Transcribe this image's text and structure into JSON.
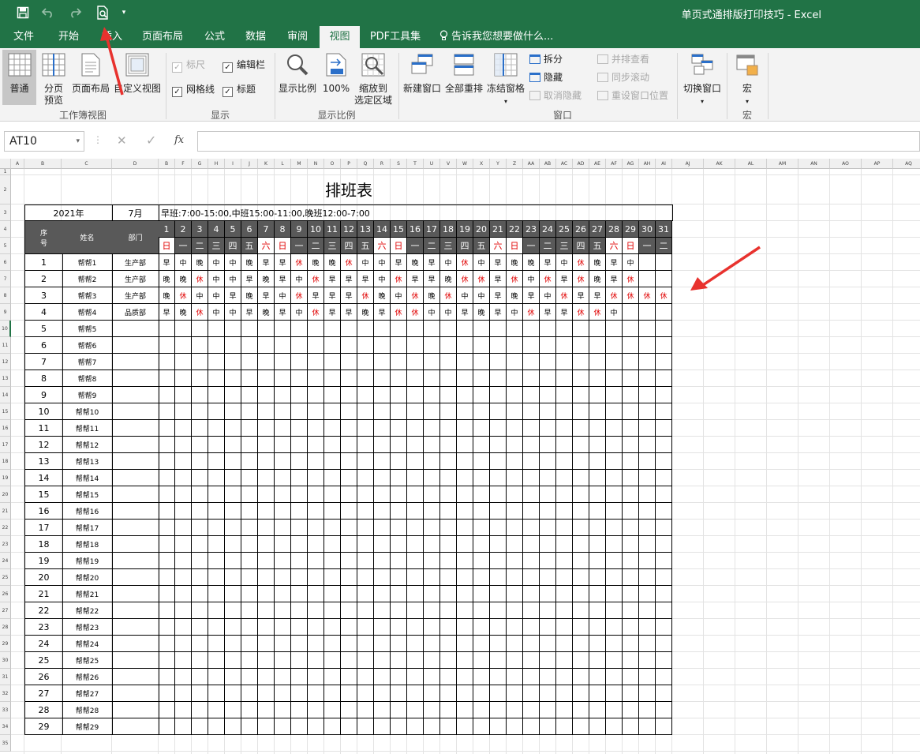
{
  "app": {
    "window_title": "单页式通排版打印技巧 - Excel"
  },
  "quick_access": {
    "save_icon": "save-icon",
    "undo_icon": "undo-icon",
    "redo_icon": "redo-icon",
    "print_preview_icon": "print-preview-icon",
    "customize_icon": "chevron-down-icon"
  },
  "tabs": [
    {
      "label": "文件"
    },
    {
      "label": "开始"
    },
    {
      "label": "插入"
    },
    {
      "label": "页面布局"
    },
    {
      "label": "公式"
    },
    {
      "label": "数据"
    },
    {
      "label": "审阅"
    },
    {
      "label": "视图"
    },
    {
      "label": "PDF工具集"
    }
  ],
  "tell_me": "告诉我您想要做什么...",
  "ribbon": {
    "workbook_views": {
      "label": "工作簿视图",
      "normal": "普通",
      "page_break_1": "分页",
      "page_break_2": "预览",
      "page_layout": "页面布局",
      "custom_views": "自定义视图"
    },
    "show": {
      "label": "显示",
      "ruler": "标尺",
      "formula_bar": "编辑栏",
      "gridlines": "网格线",
      "headings": "标题"
    },
    "zoom": {
      "label": "显示比例",
      "zoom": "显示比例",
      "hundred": "100%",
      "sel_1": "缩放到",
      "sel_2": "选定区域"
    },
    "window": {
      "label": "窗口",
      "new_window": "新建窗口",
      "arrange_all": "全部重排",
      "freeze": "冻结窗格",
      "split": "拆分",
      "hide": "隐藏",
      "unhide": "取消隐藏",
      "side_by_side": "并排查看",
      "sync_scroll": "同步滚动",
      "reset_pos": "重设窗口位置",
      "switch": "切换窗口"
    },
    "macros": {
      "label": "宏",
      "macros": "宏"
    }
  },
  "formula_bar": {
    "name_box": "AT10",
    "cancel": "✕",
    "enter": "✓",
    "fx": "fx",
    "formula": ""
  },
  "col_letters": [
    "A",
    "B",
    "C",
    "D",
    "B",
    "F",
    "G",
    "H",
    "I",
    "J",
    "K",
    "L",
    "M",
    "N",
    "O",
    "P",
    "Q",
    "R",
    "S",
    "T",
    "U",
    "V",
    "W",
    "X",
    "Y",
    "Z",
    "AA",
    "AB",
    "AC",
    "AD",
    "AE",
    "AF",
    "AG",
    "AH",
    "AI",
    "AJ",
    "AK",
    "AL",
    "AM",
    "AN",
    "AO",
    "AP",
    "AQ"
  ],
  "schedule": {
    "title": "排班表",
    "year": "2021年",
    "month": "7月",
    "legend": "早班:7:00-15:00,中班15:00-11:00,晚班12:00-7:00",
    "col_seq_1": "序",
    "col_seq_2": "号",
    "col_name": "姓名",
    "col_dept": "部门",
    "days": [
      "1",
      "2",
      "3",
      "4",
      "5",
      "6",
      "7",
      "8",
      "9",
      "10",
      "11",
      "12",
      "13",
      "14",
      "15",
      "16",
      "17",
      "18",
      "19",
      "20",
      "21",
      "22",
      "23",
      "24",
      "25",
      "26",
      "27",
      "28",
      "29",
      "30",
      "31"
    ],
    "weekdays": [
      "日",
      "一",
      "二",
      "三",
      "四",
      "五",
      "六",
      "日",
      "一",
      "二",
      "三",
      "四",
      "五",
      "六",
      "日",
      "一",
      "二",
      "三",
      "四",
      "五",
      "六",
      "日",
      "一",
      "二",
      "三",
      "四",
      "五",
      "六",
      "日",
      "一",
      "二"
    ],
    "rows": [
      {
        "seq": "1",
        "name": "帮帮1",
        "dept": "生产部",
        "shifts": [
          "早",
          "中",
          "晚",
          "中",
          "中",
          "晚",
          "早",
          "早",
          "休",
          "晚",
          "晚",
          "休",
          "中",
          "中",
          "早",
          "晚",
          "早",
          "中",
          "休",
          "中",
          "早",
          "晚",
          "晚",
          "早",
          "中",
          "休",
          "晚",
          "早",
          "中",
          "",
          ""
        ]
      },
      {
        "seq": "2",
        "name": "帮帮2",
        "dept": "生产部",
        "shifts": [
          "晚",
          "晚",
          "休",
          "中",
          "中",
          "早",
          "晚",
          "早",
          "中",
          "休",
          "早",
          "早",
          "早",
          "中",
          "休",
          "早",
          "早",
          "晚",
          "休",
          "休",
          "早",
          "休",
          "中",
          "休",
          "早",
          "休",
          "晚",
          "早",
          "休",
          "",
          ""
        ]
      },
      {
        "seq": "3",
        "name": "帮帮3",
        "dept": "生产部",
        "shifts": [
          "晚",
          "休",
          "中",
          "中",
          "早",
          "晚",
          "早",
          "中",
          "休",
          "早",
          "早",
          "早",
          "休",
          "晚",
          "中",
          "休",
          "晚",
          "休",
          "中",
          "中",
          "早",
          "晚",
          "早",
          "中",
          "休",
          "早",
          "早",
          "休",
          "休",
          "休",
          "休"
        ]
      },
      {
        "seq": "4",
        "name": "帮帮4",
        "dept": "品质部",
        "shifts": [
          "早",
          "晚",
          "休",
          "中",
          "中",
          "早",
          "晚",
          "早",
          "中",
          "休",
          "早",
          "早",
          "晚",
          "早",
          "休",
          "休",
          "中",
          "中",
          "早",
          "晚",
          "早",
          "中",
          "休",
          "早",
          "早",
          "休",
          "休",
          "中",
          "",
          "",
          ""
        ]
      },
      {
        "seq": "5",
        "name": "帮帮5",
        "dept": "",
        "shifts": []
      },
      {
        "seq": "6",
        "name": "帮帮6",
        "dept": "",
        "shifts": []
      },
      {
        "seq": "7",
        "name": "帮帮7",
        "dept": "",
        "shifts": []
      },
      {
        "seq": "8",
        "name": "帮帮8",
        "dept": "",
        "shifts": []
      },
      {
        "seq": "9",
        "name": "帮帮9",
        "dept": "",
        "shifts": []
      },
      {
        "seq": "10",
        "name": "帮帮10",
        "dept": "",
        "shifts": []
      },
      {
        "seq": "11",
        "name": "帮帮11",
        "dept": "",
        "shifts": []
      },
      {
        "seq": "12",
        "name": "帮帮12",
        "dept": "",
        "shifts": []
      },
      {
        "seq": "13",
        "name": "帮帮13",
        "dept": "",
        "shifts": []
      },
      {
        "seq": "14",
        "name": "帮帮14",
        "dept": "",
        "shifts": []
      },
      {
        "seq": "15",
        "name": "帮帮15",
        "dept": "",
        "shifts": []
      },
      {
        "seq": "16",
        "name": "帮帮16",
        "dept": "",
        "shifts": []
      },
      {
        "seq": "17",
        "name": "帮帮17",
        "dept": "",
        "shifts": []
      },
      {
        "seq": "18",
        "name": "帮帮18",
        "dept": "",
        "shifts": []
      },
      {
        "seq": "19",
        "name": "帮帮19",
        "dept": "",
        "shifts": []
      },
      {
        "seq": "20",
        "name": "帮帮20",
        "dept": "",
        "shifts": []
      },
      {
        "seq": "21",
        "name": "帮帮21",
        "dept": "",
        "shifts": []
      },
      {
        "seq": "22",
        "name": "帮帮22",
        "dept": "",
        "shifts": []
      },
      {
        "seq": "23",
        "name": "帮帮23",
        "dept": "",
        "shifts": []
      },
      {
        "seq": "24",
        "name": "帮帮24",
        "dept": "",
        "shifts": []
      },
      {
        "seq": "25",
        "name": "帮帮25",
        "dept": "",
        "shifts": []
      },
      {
        "seq": "26",
        "name": "帮帮26",
        "dept": "",
        "shifts": []
      },
      {
        "seq": "27",
        "name": "帮帮27",
        "dept": "",
        "shifts": []
      },
      {
        "seq": "28",
        "name": "帮帮28",
        "dept": "",
        "shifts": []
      },
      {
        "seq": "29",
        "name": "帮帮29",
        "dept": "",
        "shifts": []
      }
    ]
  },
  "colors": {
    "brand_green": "#217346",
    "header_dark": "#595959",
    "weekend_red": "#e00000",
    "annotation_arrow": "#e8322e"
  }
}
